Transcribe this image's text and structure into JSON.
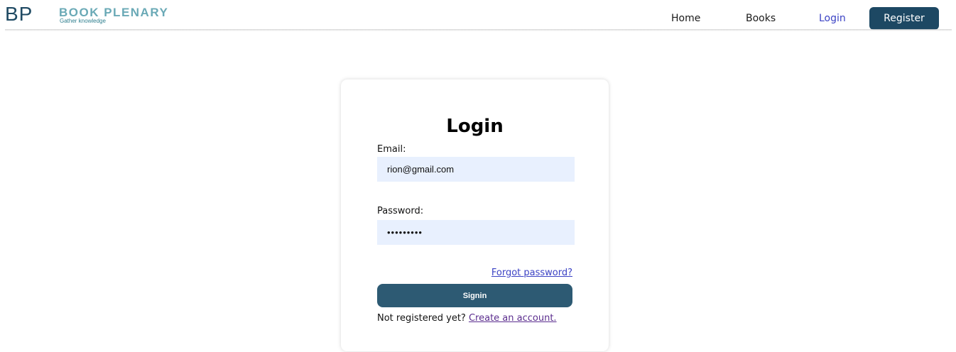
{
  "header": {
    "logo": {
      "mark": "BP",
      "name": "BOOK PLENARY",
      "tagline": "Gather knowledge"
    },
    "nav": {
      "home": "Home",
      "books": "Books",
      "login": "Login",
      "register": "Register"
    }
  },
  "login_form": {
    "title": "Login",
    "email_label": "Email:",
    "email_value": "rion@gmail.com",
    "password_label": "Password:",
    "password_value": "•••••••••",
    "forgot_password": "Forgot password?",
    "signin_button": "Signin",
    "not_registered": "Not registered yet?",
    "create_account": "Create an account."
  },
  "colors": {
    "brand_dark": "#1d4863",
    "brand_light": "#6aa9b6",
    "button": "#2d5a73",
    "input_background": "#e8f0fe",
    "link": "#3b42c4",
    "visited_link": "#5b2d8e"
  }
}
